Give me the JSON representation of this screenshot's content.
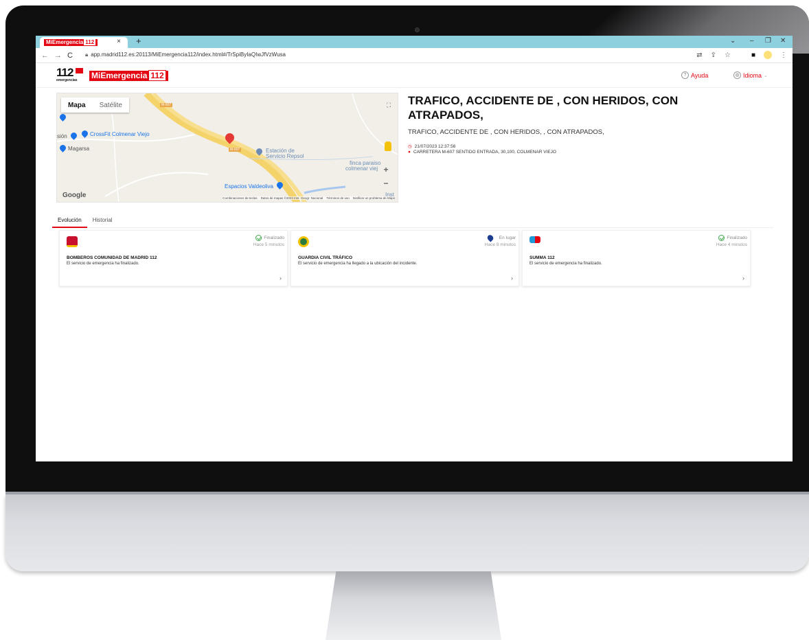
{
  "browser": {
    "tab_title": "MiEmergencia",
    "tab_title_num": "112",
    "tab_close": "×",
    "new_tab": "+",
    "url": "app.madrid112.es:20113/MiEmergencia112/index.html#/TrSpiByIaQIwJfVzWusa"
  },
  "header": {
    "logo_number": "112",
    "logo_sub": "emergencias",
    "brand_text": "MiEmergencia",
    "brand_num": "112",
    "help_label": "Ayuda",
    "language_label": "Idioma"
  },
  "map": {
    "type_map": "Mapa",
    "type_satellite": "Satélite",
    "labels": {
      "crossfit": "CrossFit Colmenar Viejo",
      "sion": "sión",
      "magarsa": "Magarsa",
      "estacion": "Estación de",
      "estacion2": "Servicio Repsol",
      "finca": "finca paraiso",
      "colmenar": "colmenar viej",
      "espacios": "Espacios Valdeoliva",
      "inst": "Inst",
      "road1": "M-607",
      "road2": "M-607"
    },
    "google": "Google",
    "attribution": [
      "Combinaciones de teclas",
      "Datos de mapas ©2023 Inst. Geogr. Nacional",
      "Términos de uso",
      "Notificar un problema de Maps"
    ]
  },
  "incident": {
    "title": "TRAFICO, ACCIDENTE DE , CON HERIDOS,   CON ATRAPADOS,",
    "subtitle": "TRAFICO, ACCIDENTE DE , CON HERIDOS, , CON ATRAPADOS,",
    "datetime": "21/07/2023 12:37:56",
    "address": "CARRETERA M-607 SENTIDO ENTRADA, 30,100, COLMENAR VIEJO"
  },
  "tabs": {
    "evolucion": "Evolución",
    "historial": "Historial"
  },
  "cards": [
    {
      "status": "Finalizado",
      "time": "Hace 5 minutos",
      "name": "BOMBEROS COMUNIDAD DE MADRID 112",
      "desc": "El servicio de emergencia ha finalizado."
    },
    {
      "status": "En lugar",
      "time": "Hace 9 minutos",
      "name": "GUARDIA CIVIL TRÁFICO",
      "desc": "El servicio de emergencia ha llegado a la ubicación del incidente."
    },
    {
      "status": "Finalizado",
      "time": "Hace 4 minutos",
      "name": "SUMMA 112",
      "desc": "El servicio de emergencia ha finalizado."
    }
  ],
  "colors": {
    "brand_red": "#e30613",
    "tabbar": "#8fd0df",
    "status_ok": "#3fa94a",
    "status_place": "#1d3c8f"
  }
}
